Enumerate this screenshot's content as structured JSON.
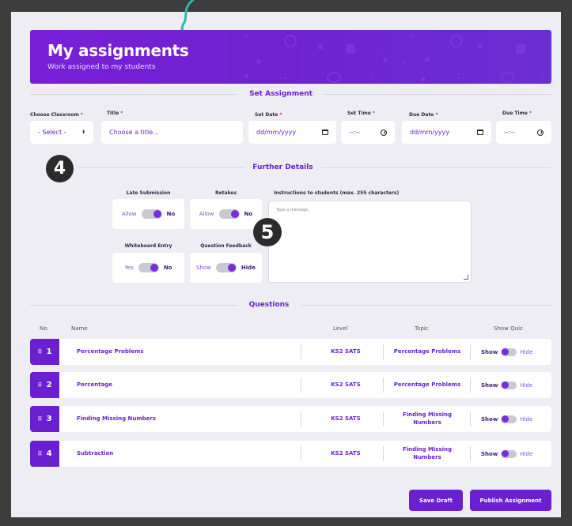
{
  "header": {
    "title": "My assignments",
    "subtitle": "Work assigned to my students"
  },
  "annotations": {
    "badge_4": "4",
    "badge_5": "5"
  },
  "set_assignment": {
    "section_title": "Set Assignment",
    "classroom": {
      "label": "Choose Classroom",
      "value": "- Select -"
    },
    "title": {
      "label": "Title",
      "placeholder": "Choose a title..."
    },
    "set_date": {
      "label": "Set Date",
      "value": "dd/mm/yyyy"
    },
    "set_time": {
      "label": "Set Time",
      "value": "--:--"
    },
    "due_date": {
      "label": "Due Date",
      "value": "dd/mm/yyyy"
    },
    "due_time": {
      "label": "Due Time",
      "value": "--:--"
    }
  },
  "further_details": {
    "section_title": "Further Details",
    "late_submission": {
      "label": "Late Submission",
      "left": "Allow",
      "right": "No"
    },
    "retakes": {
      "label": "Retakes",
      "left": "Allow",
      "right": "No"
    },
    "whiteboard_entry": {
      "label": "Whiteboard Entry",
      "left": "Yes",
      "right": "No"
    },
    "question_feedback": {
      "label": "Question Feedback",
      "left": "Show",
      "right": "Hide"
    },
    "instructions": {
      "label": "Instructions to students (max. 255 characters)",
      "placeholder": "Type a message.."
    }
  },
  "questions": {
    "section_title": "Questions",
    "columns": {
      "no": "No.",
      "name": "Name",
      "level": "Level",
      "topic": "Topic",
      "show_quiz": "Show Quiz"
    },
    "rows": [
      {
        "num": "1",
        "name": "Percentage Problems",
        "level": "KS2 SATS",
        "topic": "Percentage Problems",
        "show": "Show",
        "hide": "Hide"
      },
      {
        "num": "2",
        "name": "Percentage",
        "level": "KS2 SATS",
        "topic": "Percentage Problems",
        "show": "Show",
        "hide": "Hide"
      },
      {
        "num": "3",
        "name": "Finding Missing Numbers",
        "level": "KS2 SATS",
        "topic": "Finding Missing Numbers",
        "show": "Show",
        "hide": "Hide"
      },
      {
        "num": "4",
        "name": "Subtraction",
        "level": "KS2 SATS",
        "topic": "Finding Missing Numbers",
        "show": "Show",
        "hide": "Hide"
      }
    ]
  },
  "actions": {
    "save_draft": "Save Draft",
    "publish": "Publish Assignment"
  },
  "colors": {
    "brand": "#6a1fd0",
    "required": "#e02a4a",
    "annotation_arrow": "#1fbfae"
  }
}
